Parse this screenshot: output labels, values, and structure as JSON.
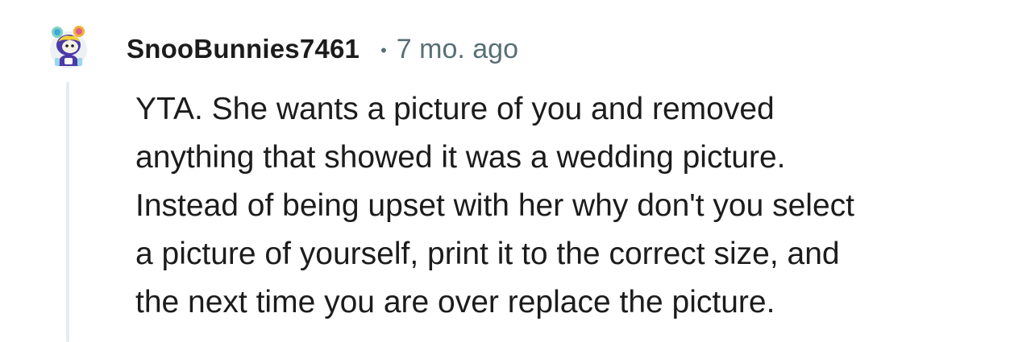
{
  "comment": {
    "avatar_icon": "snoo-avatar-icon",
    "username": "SnooBunnies7461",
    "separator": "•",
    "timestamp": "7 mo. ago",
    "body_lines": [
      "YTA. She wants a picture of you and removed",
      "anything that showed it was a wedding picture.",
      "Instead of being upset with her why don't you select",
      "a picture of yourself, print it to the correct size, and",
      "the next time you are over replace the picture."
    ]
  },
  "colors": {
    "username": "#1c1c1c",
    "meta": "#576f76",
    "thread_line": "#e5ebee",
    "avatar_body": "#4b3aa8"
  }
}
